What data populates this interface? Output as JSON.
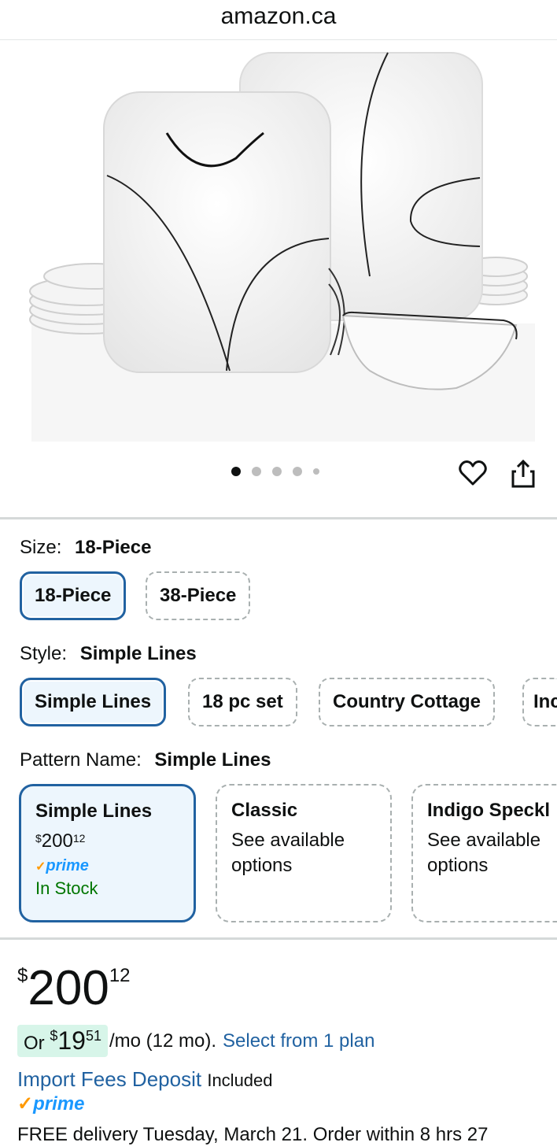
{
  "header": {
    "domain": "amazon.ca"
  },
  "gallery": {
    "image_count": 5,
    "active_index": 0
  },
  "icons": {
    "wishlist": "heart-icon",
    "share": "share-icon"
  },
  "size": {
    "label": "Size:",
    "selected": "18-Piece",
    "options": [
      "18-Piece",
      "38-Piece"
    ]
  },
  "style": {
    "label": "Style:",
    "selected": "Simple Lines",
    "options": [
      "Simple Lines",
      "18 pc set",
      "Country Cottage",
      "Inc"
    ]
  },
  "pattern": {
    "label": "Pattern Name:",
    "selected": "Simple Lines",
    "cards": [
      {
        "title": "Simple Lines",
        "price_symbol": "$",
        "price_whole": "200",
        "price_fraction": "12",
        "prime": "prime",
        "availability": "In Stock"
      },
      {
        "title": "Classic",
        "subtitle": "See available options"
      },
      {
        "title": "Indigo Speckl",
        "subtitle": "See available options"
      }
    ]
  },
  "price": {
    "symbol": "$",
    "whole": "200",
    "fraction": "12"
  },
  "monthly": {
    "prefix": "Or ",
    "symbol": "$",
    "whole": "19",
    "fraction": "51",
    "suffix": "/mo (12 mo).",
    "link": "Select from 1 plan"
  },
  "import_fees": {
    "link": "Import Fees Deposit",
    "note": "Included"
  },
  "prime_badge": "prime",
  "delivery": {
    "text": "FREE delivery Tuesday, March 21. Order within 8 hrs 27"
  },
  "colors": {
    "link": "#2162a1",
    "selected_border": "#2162a1",
    "prime_blue": "#1a98ff",
    "prime_check": "#ff9900",
    "in_stock": "#007600",
    "installment_highlight": "#d7f5e9"
  }
}
